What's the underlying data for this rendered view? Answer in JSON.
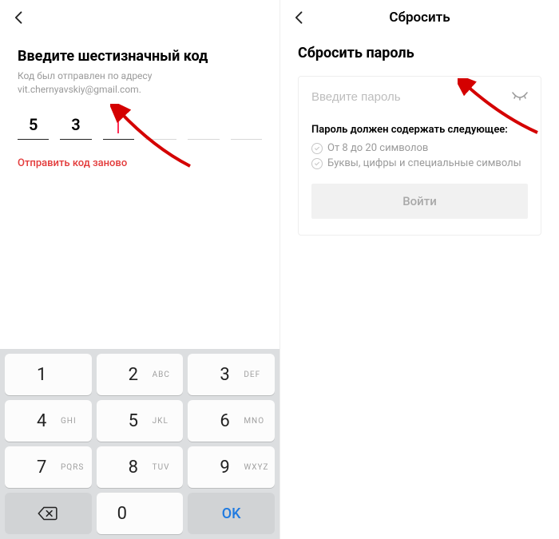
{
  "left": {
    "title": "Введите шестизначный код",
    "subtitle_prefix": "Код был отправлен по адресу ",
    "email": "vit.chernyavskiy@gmail.com",
    "subtitle_suffix": ".",
    "code_digits": [
      "5",
      "3",
      "",
      "",
      "",
      ""
    ],
    "active_index": 2,
    "resend": "Отправить код заново"
  },
  "right": {
    "header_title": "Сбросить",
    "title": "Сбросить пароль",
    "password_placeholder": "Введите пароль",
    "req_title": "Пароль должен содержать следующее:",
    "req1": "От 8 до 20 символов",
    "req2": "Буквы, цифры и специальные символы",
    "login_btn": "Войти"
  },
  "keypad": {
    "keys": [
      {
        "num": "1",
        "letters": ""
      },
      {
        "num": "2",
        "letters": "ABC"
      },
      {
        "num": "3",
        "letters": "DEF"
      },
      {
        "num": "4",
        "letters": "GHI"
      },
      {
        "num": "5",
        "letters": "JKL"
      },
      {
        "num": "6",
        "letters": "MNO"
      },
      {
        "num": "7",
        "letters": "PQRS"
      },
      {
        "num": "8",
        "letters": "TUV"
      },
      {
        "num": "9",
        "letters": "WXYZ"
      }
    ],
    "zero": "0",
    "ok": "OK"
  }
}
